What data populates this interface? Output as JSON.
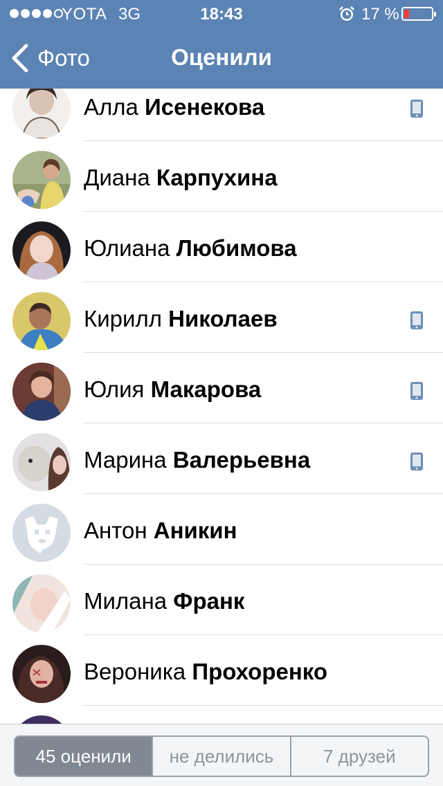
{
  "status_bar": {
    "carrier": "YOTA",
    "network": "3G",
    "time": "18:43",
    "battery_percent": "17 %",
    "icons": [
      "signal-dots-icon",
      "alarm-icon",
      "battery-icon"
    ]
  },
  "nav": {
    "back_label": "Фото",
    "title": "Оценили",
    "background_color": "#5b83b4"
  },
  "people": [
    {
      "first": "Алла",
      "last": "Исенекова",
      "mobile": true
    },
    {
      "first": "Диана",
      "last": "Карпухина",
      "mobile": false
    },
    {
      "first": "Юлиана",
      "last": "Любимова",
      "mobile": false
    },
    {
      "first": "Кирилл",
      "last": "Николаев",
      "mobile": true
    },
    {
      "first": "Юлия",
      "last": "Макарова",
      "mobile": true
    },
    {
      "first": "Марина",
      "last": "Валерьевна",
      "mobile": true
    },
    {
      "first": "Антон",
      "last": "Аникин",
      "mobile": false
    },
    {
      "first": "Милана",
      "last": "Франк",
      "mobile": false
    },
    {
      "first": "Вероника",
      "last": "Прохоренко",
      "mobile": false
    }
  ],
  "tabs": [
    {
      "label": "45 оценили",
      "active": true
    },
    {
      "label": "не делились",
      "active": false
    },
    {
      "label": "7 друзей",
      "active": false
    }
  ],
  "colors": {
    "accent": "#5b83b4",
    "mobile_icon": "#6e8eb8",
    "active_tab": "#808892",
    "battery_low": "#ff3b30"
  }
}
